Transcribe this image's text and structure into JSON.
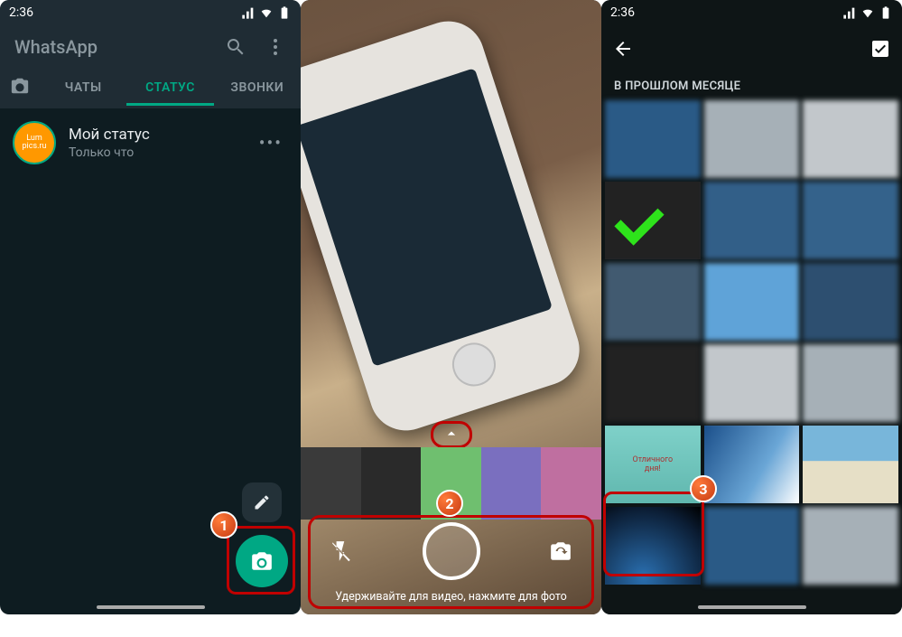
{
  "statusbar": {
    "time": "2:36"
  },
  "screen1": {
    "app_title": "WhatsApp",
    "tabs": {
      "chats": "ЧАТЫ",
      "status": "СТАТУС",
      "calls": "ЗВОНКИ"
    },
    "my_status": {
      "title": "Мой статус",
      "subtitle": "Только что",
      "avatar_text": "Lum\npics.ru"
    },
    "more": "•••"
  },
  "screen2": {
    "hint": "Удерживайте для видео, нажмите для фото",
    "strip_colors": [
      "#3a3a3a",
      "#2a2a2a",
      "#6fbf6f",
      "#7a6fbf",
      "#bf6fa0"
    ]
  },
  "screen3": {
    "section": "В ПРОШЛОМ МЕСЯЦЕ",
    "cat_text": "Отличного\nдня!"
  },
  "callouts": {
    "one": "1",
    "two": "2",
    "three": "3"
  }
}
